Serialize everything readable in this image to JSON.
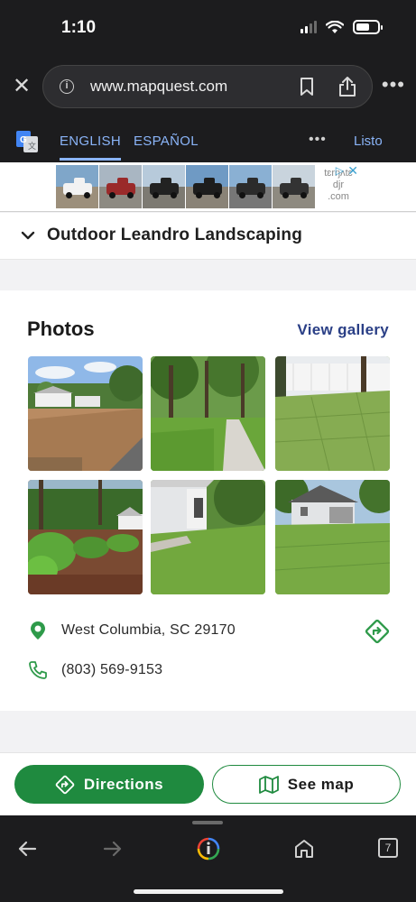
{
  "status_bar": {
    "time": "1:10"
  },
  "browser": {
    "url": "www.mapquest.com",
    "tab_count": "7"
  },
  "translate": {
    "languages": [
      "ENGLISH",
      "ESPAÑOL"
    ],
    "active_language": "ENGLISH",
    "more_label": "•••",
    "done_label": "Listo"
  },
  "ad": {
    "text": "tɛrŋʌtɛ djr .com",
    "text_lines": [
      "tɛrŋʌtɛ",
      "djr",
      ".com"
    ]
  },
  "business": {
    "name": "Outdoor Leandro Landscaping"
  },
  "photos": {
    "title": "Photos",
    "gallery_link": "View gallery"
  },
  "contact": {
    "address": "West Columbia, SC 29170",
    "phone": "(803) 569-9153"
  },
  "actions": {
    "directions_label": "Directions",
    "map_label": "See map"
  },
  "colors": {
    "accent_green": "#1f8a3f",
    "link_blue": "#2a3f86",
    "translate_blue": "#8ab4f8"
  }
}
